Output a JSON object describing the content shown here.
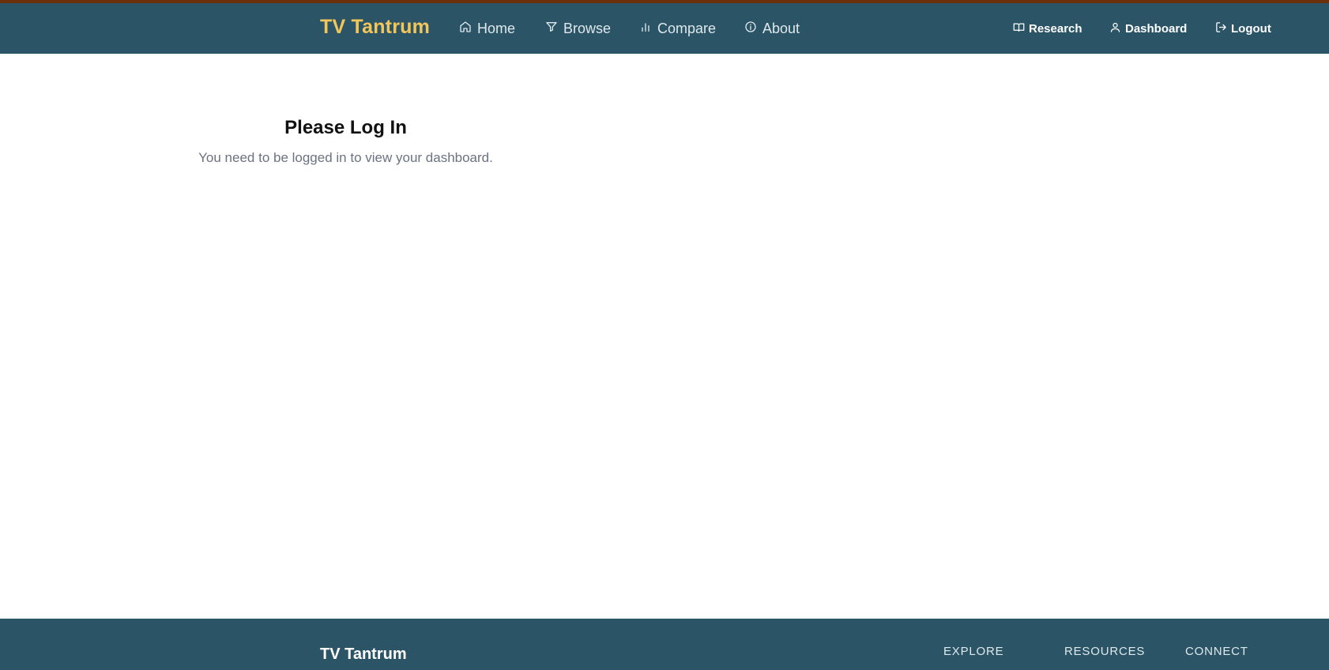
{
  "header": {
    "brand": "TV Tantrum",
    "nav": [
      {
        "label": "Home",
        "icon": "home-icon"
      },
      {
        "label": "Browse",
        "icon": "filter-icon"
      },
      {
        "label": "Compare",
        "icon": "bar-chart-icon"
      },
      {
        "label": "About",
        "icon": "info-icon"
      }
    ],
    "right_nav": [
      {
        "label": "Research",
        "icon": "book-open-icon"
      },
      {
        "label": "Dashboard",
        "icon": "user-icon"
      },
      {
        "label": "Logout",
        "icon": "logout-icon"
      }
    ]
  },
  "main": {
    "title": "Please Log In",
    "message": "You need to be logged in to view your dashboard."
  },
  "footer": {
    "brand": "TV Tantrum",
    "columns": [
      "EXPLORE",
      "RESOURCES",
      "CONNECT"
    ]
  },
  "colors": {
    "navbar": "#2b5566",
    "top_strip": "#6b2f0c",
    "brand": "#f2c65a",
    "muted_text": "#6b7280"
  }
}
